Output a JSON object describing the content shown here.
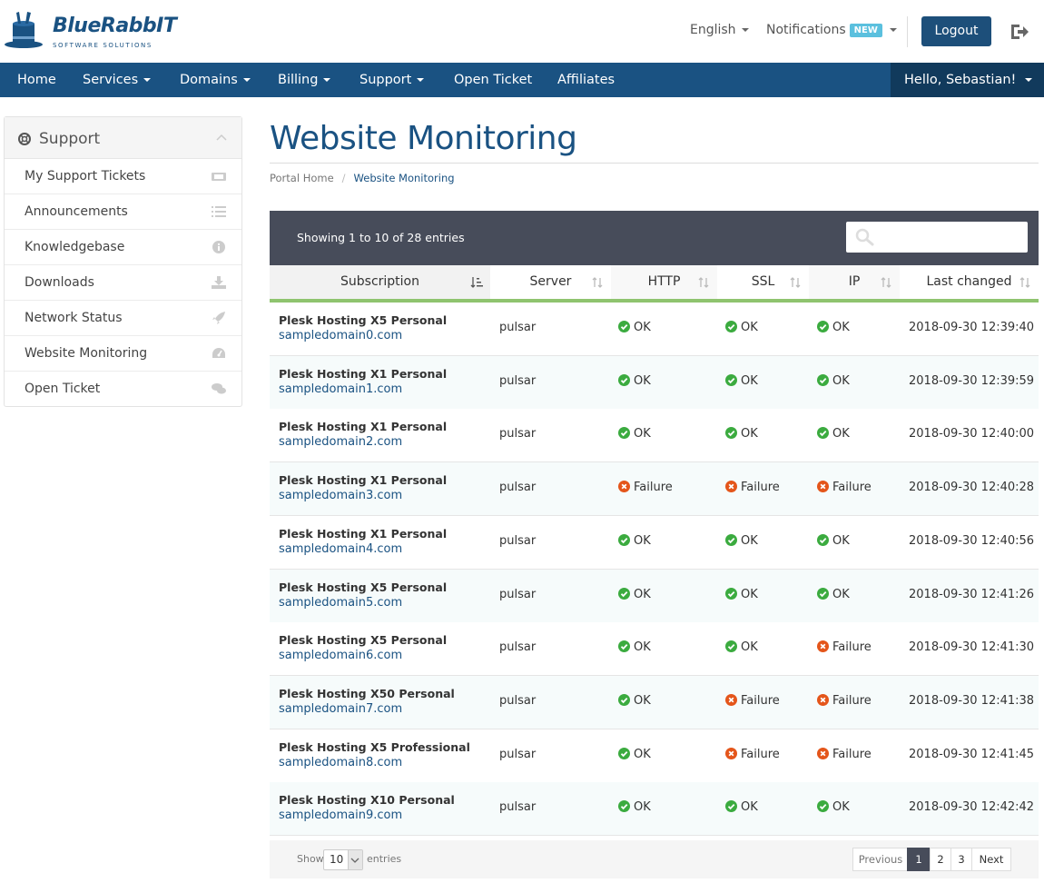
{
  "header": {
    "brand": "BlueRabbIT",
    "brand_tagline": "SOFTWARE SOLUTIONS",
    "language": "English",
    "notifications_label": "Notifications",
    "notifications_badge": "NEW",
    "logout_label": "Logout"
  },
  "nav": {
    "items": [
      {
        "label": "Home",
        "dropdown": false
      },
      {
        "label": "Services",
        "dropdown": true
      },
      {
        "label": "Domains",
        "dropdown": true
      },
      {
        "label": "Billing",
        "dropdown": true
      },
      {
        "label": "Support",
        "dropdown": true
      },
      {
        "label": "Open Ticket",
        "dropdown": false
      },
      {
        "label": "Affiliates",
        "dropdown": false
      }
    ],
    "user_greeting": "Hello, Sebastian!"
  },
  "sidebar": {
    "title": "Support",
    "items": [
      {
        "label": "My Support Tickets",
        "icon": "ticket-icon"
      },
      {
        "label": "Announcements",
        "icon": "list-icon"
      },
      {
        "label": "Knowledgebase",
        "icon": "info-icon"
      },
      {
        "label": "Downloads",
        "icon": "download-icon"
      },
      {
        "label": "Network Status",
        "icon": "rocket-icon"
      },
      {
        "label": "Website Monitoring",
        "icon": "dashboard-icon"
      },
      {
        "label": "Open Ticket",
        "icon": "comments-icon"
      }
    ]
  },
  "page": {
    "title": "Website Monitoring",
    "breadcrumb": [
      "Portal Home",
      "Website Monitoring"
    ]
  },
  "table": {
    "info": "Showing 1 to 10 of 28 entries",
    "columns": [
      "Subscription",
      "Server",
      "HTTP",
      "SSL",
      "IP",
      "Last changed"
    ],
    "rows": [
      {
        "plan": "Plesk Hosting X5 Personal",
        "domain": "sampledomain0.com",
        "server": "pulsar",
        "http": "OK",
        "ssl": "OK",
        "ip": "OK",
        "changed": "2018-09-30 12:39:40"
      },
      {
        "plan": "Plesk Hosting X1 Personal",
        "domain": "sampledomain1.com",
        "server": "pulsar",
        "http": "OK",
        "ssl": "OK",
        "ip": "OK",
        "changed": "2018-09-30 12:39:59"
      },
      {
        "plan": "Plesk Hosting X1 Personal",
        "domain": "sampledomain2.com",
        "server": "pulsar",
        "http": "OK",
        "ssl": "OK",
        "ip": "OK",
        "changed": "2018-09-30 12:40:00"
      },
      {
        "plan": "Plesk Hosting X1 Personal",
        "domain": "sampledomain3.com",
        "server": "pulsar",
        "http": "Failure",
        "ssl": "Failure",
        "ip": "Failure",
        "changed": "2018-09-30 12:40:28"
      },
      {
        "plan": "Plesk Hosting X1 Personal",
        "domain": "sampledomain4.com",
        "server": "pulsar",
        "http": "OK",
        "ssl": "OK",
        "ip": "OK",
        "changed": "2018-09-30 12:40:56"
      },
      {
        "plan": "Plesk Hosting X5 Personal",
        "domain": "sampledomain5.com",
        "server": "pulsar",
        "http": "OK",
        "ssl": "OK",
        "ip": "OK",
        "changed": "2018-09-30 12:41:26"
      },
      {
        "plan": "Plesk Hosting X5 Personal",
        "domain": "sampledomain6.com",
        "server": "pulsar",
        "http": "OK",
        "ssl": "OK",
        "ip": "Failure",
        "changed": "2018-09-30 12:41:30"
      },
      {
        "plan": "Plesk Hosting X50 Personal",
        "domain": "sampledomain7.com",
        "server": "pulsar",
        "http": "OK",
        "ssl": "Failure",
        "ip": "Failure",
        "changed": "2018-09-30 12:41:38"
      },
      {
        "plan": "Plesk Hosting X5 Professional",
        "domain": "sampledomain8.com",
        "server": "pulsar",
        "http": "OK",
        "ssl": "Failure",
        "ip": "Failure",
        "changed": "2018-09-30 12:41:45"
      },
      {
        "plan": "Plesk Hosting X10 Personal",
        "domain": "sampledomain9.com",
        "server": "pulsar",
        "http": "OK",
        "ssl": "OK",
        "ip": "OK",
        "changed": "2018-09-30 12:42:42"
      }
    ],
    "footer": {
      "show_label": "Show",
      "page_size": "10",
      "entries_label": "entries",
      "prev_label": "Previous",
      "pages": [
        "1",
        "2",
        "3"
      ],
      "active_page": "1",
      "next_label": "Next"
    }
  },
  "colors": {
    "brand_blue": "#1a5282",
    "nav_dark": "#113a5c",
    "panel_dark": "#474c5a",
    "header_accent": "#8fc46f",
    "ok_green": "#3bab3f",
    "failure_red": "#e4551a"
  }
}
